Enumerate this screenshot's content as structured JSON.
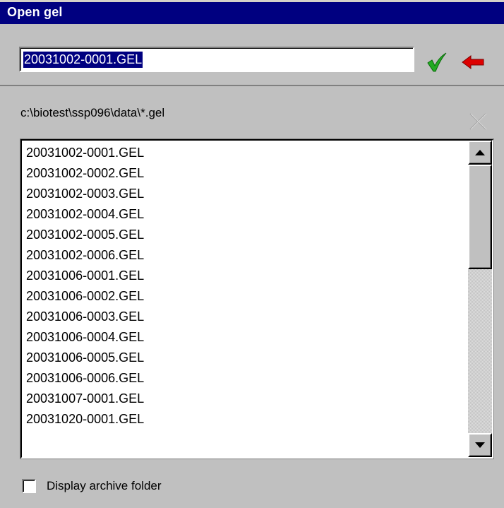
{
  "window": {
    "title": "Open gel"
  },
  "filename_input": {
    "value": "20031002-0001.GEL"
  },
  "toolbar": {
    "ok_icon": "green-checkmark-icon",
    "back_icon": "red-arrow-left-icon",
    "close_icon": "close-x-icon",
    "colors": {
      "ok": "#22aa22",
      "back": "#dd0000",
      "title_bg": "#000080",
      "selection": "#000080"
    }
  },
  "path": {
    "label": "c:\\biotest\\ssp096\\data\\*.gel"
  },
  "file_list": {
    "items": [
      "20031002-0001.GEL",
      "20031002-0002.GEL",
      "20031002-0003.GEL",
      "20031002-0004.GEL",
      "20031002-0005.GEL",
      "20031002-0006.GEL",
      "20031006-0001.GEL",
      "20031006-0002.GEL",
      "20031006-0003.GEL",
      "20031006-0004.GEL",
      "20031006-0005.GEL",
      "20031006-0006.GEL",
      "20031007-0001.GEL",
      "20031020-0001.GEL"
    ]
  },
  "archive": {
    "label": "Display archive folder",
    "checked": false
  }
}
